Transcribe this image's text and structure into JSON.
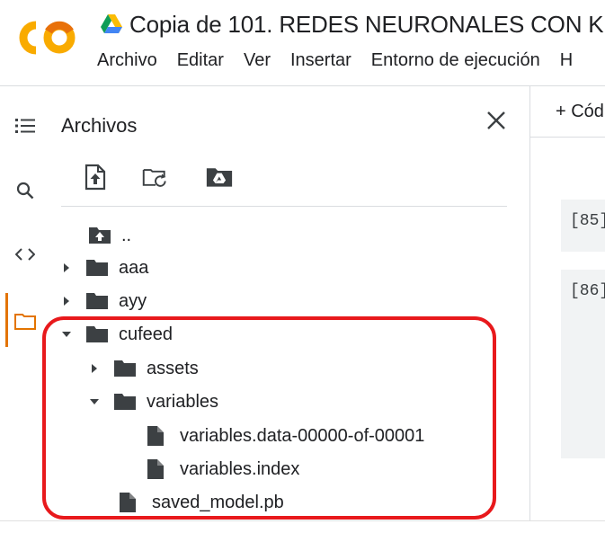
{
  "app": {
    "logo_text": "CO",
    "title": "Copia de 101. REDES NEURONALES CON K"
  },
  "menu": [
    "Archivo",
    "Editar",
    "Ver",
    "Insertar",
    "Entorno de ejecución",
    "H"
  ],
  "panel": {
    "title": "Archivos"
  },
  "tree": [
    {
      "name": "..",
      "type": "folder-up",
      "depth": 0
    },
    {
      "name": "aaa",
      "type": "folder",
      "depth": 0,
      "state": "collapsed"
    },
    {
      "name": "ayy",
      "type": "folder",
      "depth": 0,
      "state": "collapsed"
    },
    {
      "name": "cufeed",
      "type": "folder",
      "depth": 0,
      "state": "expanded"
    },
    {
      "name": "assets",
      "type": "folder",
      "depth": 1,
      "state": "collapsed"
    },
    {
      "name": "variables",
      "type": "folder",
      "depth": 1,
      "state": "expanded"
    },
    {
      "name": "variables.data-00000-of-00001",
      "type": "file",
      "depth": 2
    },
    {
      "name": "variables.index",
      "type": "file",
      "depth": 2
    },
    {
      "name": "saved_model.pb",
      "type": "file",
      "depth": 1
    }
  ],
  "notebook": {
    "add_code_label": "+ Cód",
    "cells": [
      "[85]",
      "[86]"
    ]
  },
  "colors": {
    "accent_orange": "#e37400",
    "highlight_red": "#e8191c",
    "icon_gray": "#3c4043"
  }
}
